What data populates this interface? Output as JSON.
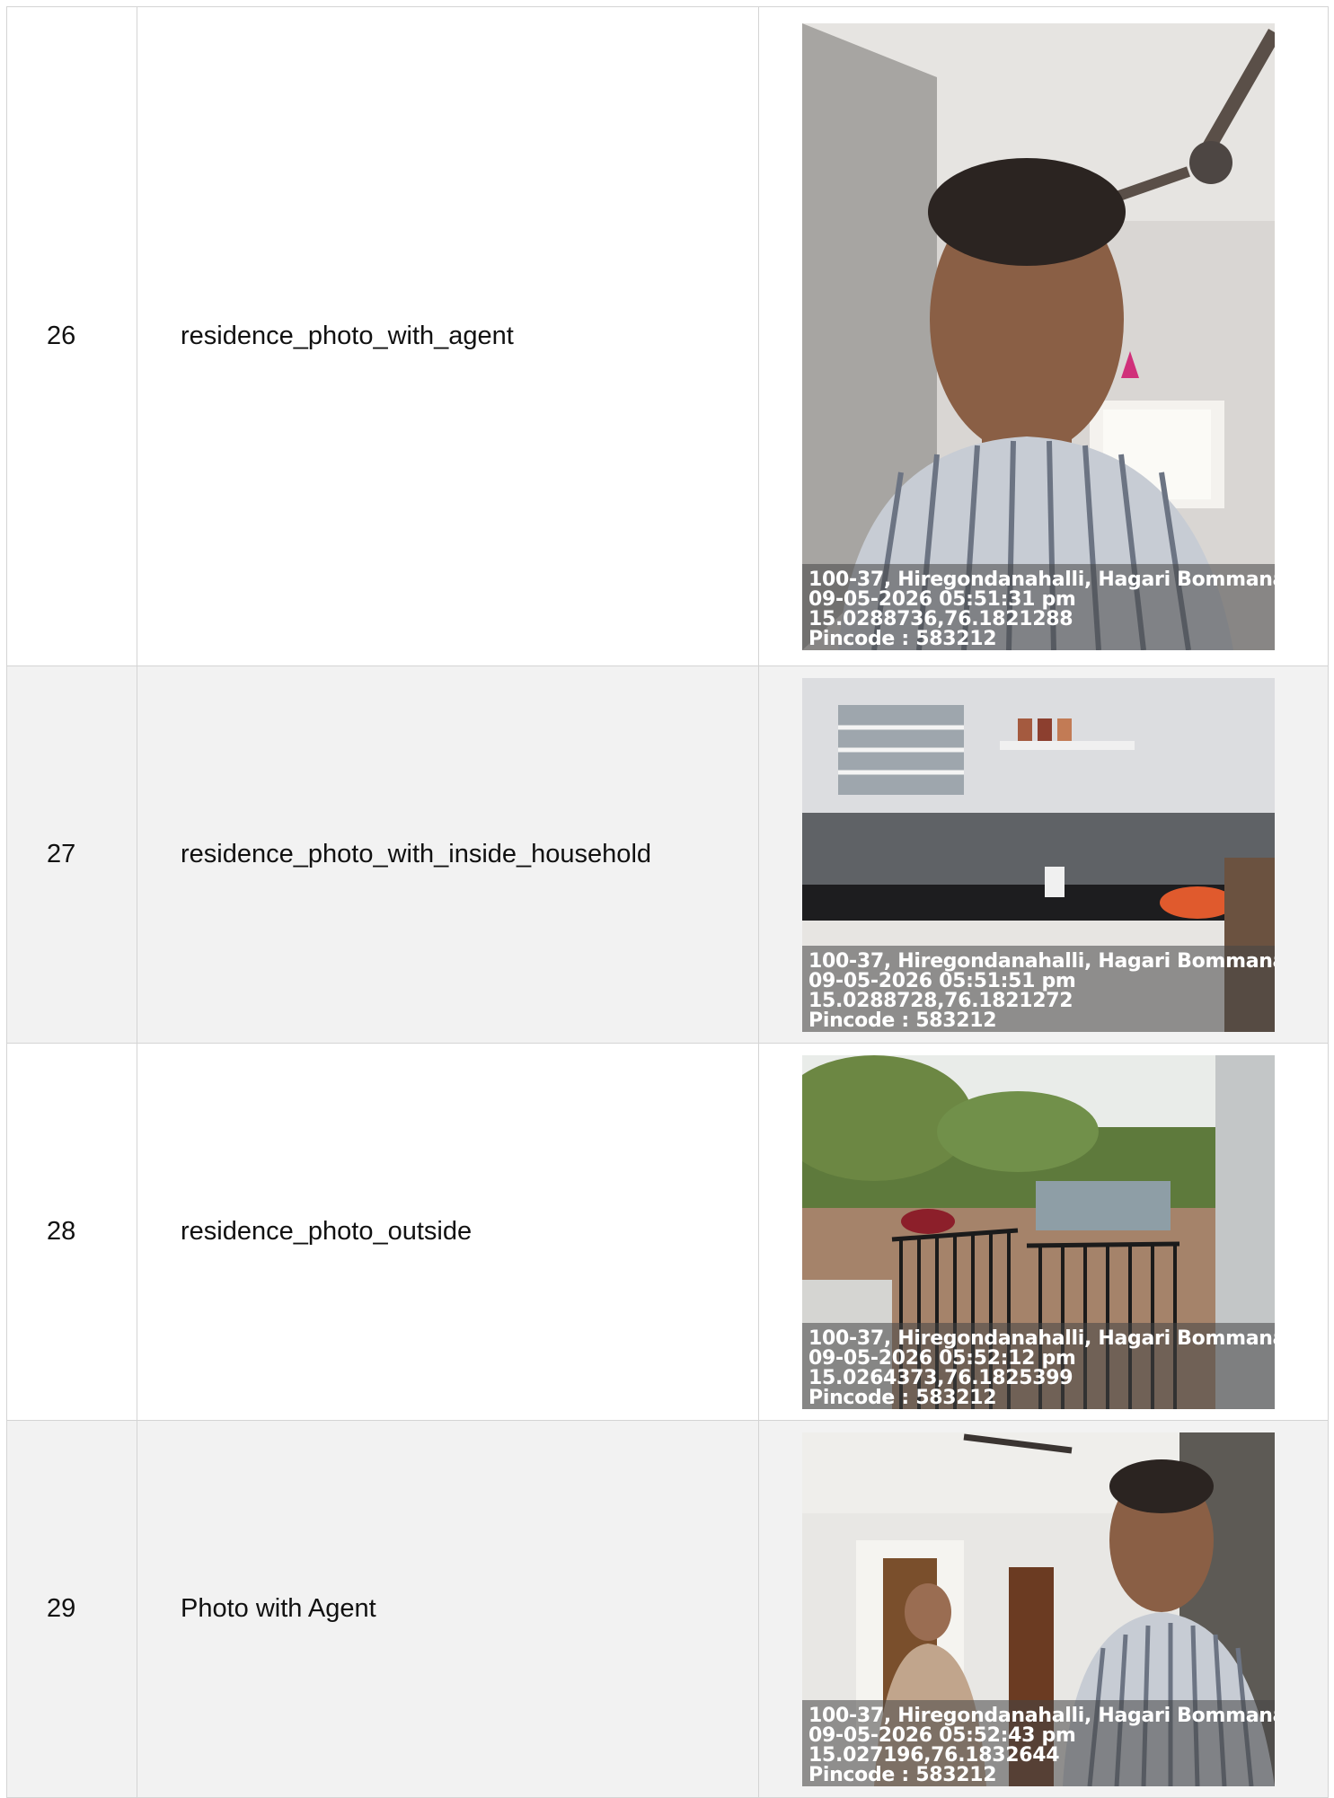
{
  "rows": [
    {
      "number": "26",
      "label": "residence_photo_with_agent",
      "photo": {
        "address": "100-37, Hiregondanahalli, Hagari Bommana",
        "datetime": "09-05-2026 05:51:31 pm",
        "coords": "15.0288736,76.1821288",
        "pincode": "Pincode : 583212"
      }
    },
    {
      "number": "27",
      "label": "residence_photo_with_inside_household",
      "photo": {
        "address": "100-37, Hiregondanahalli, Hagari Bommana",
        "datetime": "09-05-2026 05:51:51 pm",
        "coords": "15.0288728,76.1821272",
        "pincode": "Pincode : 583212"
      }
    },
    {
      "number": "28",
      "label": "residence_photo_outside",
      "photo": {
        "address": "100-37, Hiregondanahalli, Hagari Bommana",
        "datetime": "09-05-2026 05:52:12 pm",
        "coords": "15.0264373,76.1825399",
        "pincode": "Pincode : 583212"
      }
    },
    {
      "number": "29",
      "label": "Photo with Agent",
      "photo": {
        "address": "100-37, Hiregondanahalli, Hagari Bommana",
        "datetime": "09-05-2026 05:52:43 pm",
        "coords": "15.027196,76.1832644",
        "pincode": "Pincode : 583212"
      }
    }
  ]
}
